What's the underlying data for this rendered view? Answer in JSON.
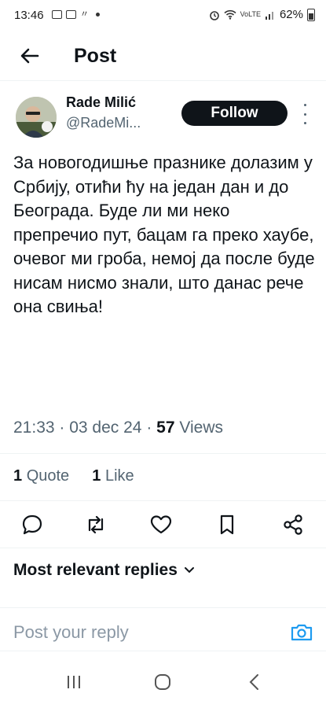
{
  "status_bar": {
    "time": "13:46",
    "battery": "62%",
    "network_label": "VoLTE"
  },
  "header": {
    "back_icon": "arrow-left-icon",
    "title": "Post"
  },
  "post": {
    "author_name": "Rade Milić",
    "author_handle": "@RadeMi...",
    "follow_label": "Follow",
    "text": "За новогодишње празнике долазим у Србију, отићи ћу на један дан и до Београда. Буде ли ми неко препречио пут, бацам га преко хаубе, очевог ми гроба, немој да после буде нисам нисмо знали, што данас рече она свиња!",
    "time": "21:33",
    "date": "03 dec 24",
    "views_count": "57",
    "views_label": "Views",
    "quotes_count": "1",
    "quotes_label": "Quote",
    "likes_count": "1",
    "likes_label": "Like"
  },
  "actions": {
    "reply_icon": "reply-icon",
    "repost_icon": "repost-icon",
    "like_icon": "heart-icon",
    "bookmark_icon": "bookmark-icon",
    "share_icon": "share-icon"
  },
  "replies": {
    "sort_label": "Most relevant replies"
  },
  "composer": {
    "placeholder": "Post your reply"
  },
  "colors": {
    "text": "#0f1419",
    "secondary": "#536471",
    "accent": "#1d9bf0",
    "button_bg": "#0f1419"
  }
}
